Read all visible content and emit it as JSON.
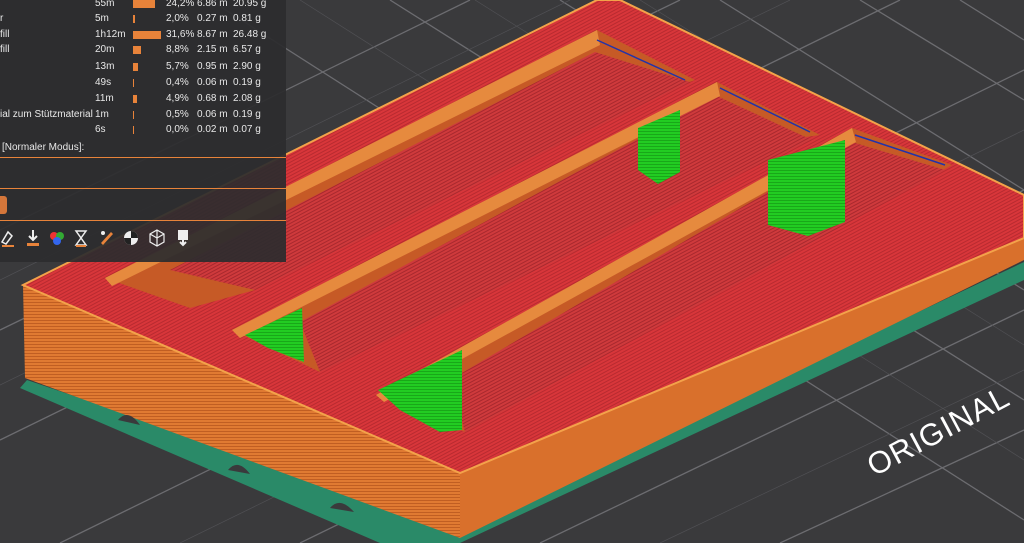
{
  "stats": {
    "rows": [
      {
        "label": "",
        "time": "55m",
        "percent": "24,2%",
        "length": "6.86 m",
        "weight": "20.95 g",
        "share": 0.242
      },
      {
        "label": "r",
        "time": "5m",
        "percent": "2,0%",
        "length": "0.27 m",
        "weight": "0.81 g",
        "share": 0.02
      },
      {
        "label": "fill",
        "time": "1h12m",
        "percent": "31,6%",
        "length": "8.67 m",
        "weight": "26.48 g",
        "share": 0.316
      },
      {
        "label": "fill",
        "time": "20m",
        "percent": "8,8%",
        "length": "2.15 m",
        "weight": "6.57 g",
        "share": 0.088
      },
      {
        "label": "",
        "time": "13m",
        "percent": "5,7%",
        "length": "0.95 m",
        "weight": "2.90 g",
        "share": 0.057
      },
      {
        "label": "",
        "time": "49s",
        "percent": "0,4%",
        "length": "0.06 m",
        "weight": "0.19 g",
        "share": 0.004
      },
      {
        "label": "",
        "time": "11m",
        "percent": "4,9%",
        "length": "0.68 m",
        "weight": "2.08 g",
        "share": 0.049
      },
      {
        "label": "ial zum Stützmaterial",
        "time": "1m",
        "percent": "0,5%",
        "length": "0.06 m",
        "weight": "0.19 g",
        "share": 0.005
      },
      {
        "label": "",
        "time": "6s",
        "percent": "0,0%",
        "length": "0.02 m",
        "weight": "0.07 g",
        "share": 0.0
      }
    ],
    "mode_label": "[Normaler Modus]:"
  },
  "toolbar": {
    "icons": [
      "layers-edit-icon",
      "download-arrow-icon",
      "color-wheel-icon",
      "hourglass-icon",
      "pen-gcode-icon",
      "target-ring-icon",
      "wireframe-cube-icon",
      "export-arrow-icon"
    ]
  },
  "bed": {
    "label": "ORIGINAL"
  },
  "colors": {
    "perimeter": "#e8762c",
    "top_solid": "#d9353b",
    "support": "#22cc22",
    "stats_bar": "#e8833a",
    "bed": "#3a3a3c"
  }
}
